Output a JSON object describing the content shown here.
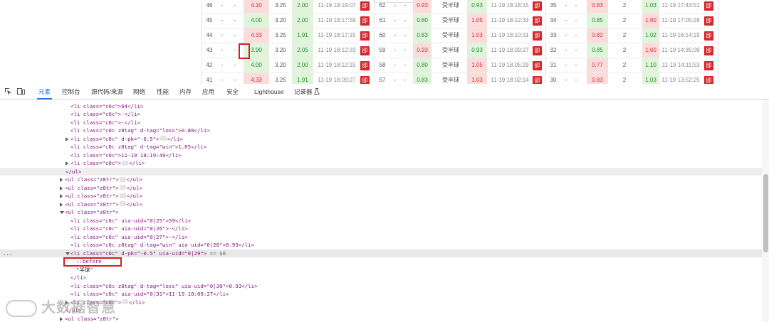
{
  "odds_table": {
    "rows": [
      {
        "a": {
          "id": "46",
          "d1": "-",
          "d2": "-",
          "v1": "4.10",
          "v2": "3.25",
          "v3": "2.00",
          "time": "11-19 18:19:07",
          "btn": "即"
        },
        "b": {
          "id": "62",
          "d1": "-",
          "d2": "-",
          "v1": "0.93",
          "pk": "受半球",
          "v2": "0.93",
          "time": "11-19 18:18:15",
          "btn": "即"
        },
        "c": {
          "id": "35",
          "d1": "-",
          "d2": "-",
          "v1": "0.83",
          "v2": "2",
          "v3": "1.03",
          "time": "11-19 17:43:51",
          "btn": "即"
        }
      },
      {
        "a": {
          "id": "45",
          "d1": "-",
          "d2": "-",
          "v1": "4.00",
          "v2": "3.20",
          "v3": "2.00",
          "time": "11-19 18:17:59",
          "btn": "即"
        },
        "b": {
          "id": "61",
          "d1": "-",
          "d2": "-",
          "v1": "0.80",
          "pk": "受半球",
          "v2": "1.05",
          "time": "11-19 18:12:33",
          "btn": "即"
        },
        "c": {
          "id": "34",
          "d1": "-",
          "d2": "-",
          "v1": "0.85",
          "v2": "2",
          "v3": "1.00",
          "time": "11-19 17:05:18",
          "btn": "即"
        }
      },
      {
        "a": {
          "id": "44",
          "d1": "-",
          "d2": "-",
          "v1": "4.33",
          "v2": "3.25",
          "v3": "1.91",
          "time": "11-19 18:17:15",
          "btn": "即"
        },
        "b": {
          "id": "60",
          "d1": "-",
          "d2": "-",
          "v1": "0.83",
          "pk": "受半球",
          "v2": "1.03",
          "time": "11-19 18:10:31",
          "btn": "即"
        },
        "c": {
          "id": "33",
          "d1": "-",
          "d2": "-",
          "v1": "0.82",
          "v2": "2",
          "v3": "1.02",
          "time": "11-19 16:14:19",
          "btn": "即"
        }
      },
      {
        "a": {
          "id": "43",
          "d1": "-",
          "d2": "-",
          "v1": "3.90",
          "v2": "3.20",
          "v3": "2.05",
          "time": "11-19 18:12:33",
          "btn": "即"
        },
        "b": {
          "id": "59",
          "d1": "-",
          "d2": "-",
          "v1": "0.93",
          "pk": "受半球",
          "v2": "0.93",
          "time": "11-19 18:09:27",
          "btn": "即"
        },
        "c": {
          "id": "32",
          "d1": "-",
          "d2": "-",
          "v1": "0.85",
          "v2": "2",
          "v3": "1.00",
          "time": "11-19 14:35:09",
          "btn": "即"
        }
      },
      {
        "a": {
          "id": "42",
          "d1": "-",
          "d2": "-",
          "v1": "4.00",
          "v2": "3.20",
          "v3": "2.00",
          "time": "11-19 18:12:15",
          "btn": "即"
        },
        "b": {
          "id": "58",
          "d1": "-",
          "d2": "-",
          "v1": "0.80",
          "pk": "受半球",
          "v2": "1.05",
          "time": "11-19 18:05:29",
          "btn": "即"
        },
        "c": {
          "id": "31",
          "d1": "-",
          "d2": "-",
          "v1": "0.77",
          "v2": "2",
          "v3": "1.10",
          "time": "11-19 14:11:53",
          "btn": "即"
        }
      },
      {
        "a": {
          "id": "41",
          "d1": "-",
          "d2": "-",
          "v1": "4.33",
          "v2": "3.25",
          "v3": "1.91",
          "time": "11-19 18:09:27",
          "btn": "即"
        },
        "b": {
          "id": "57",
          "d1": "-",
          "d2": "-",
          "v1": "0.83",
          "pk": "受半球",
          "v2": "1.03",
          "time": "11-19 18:02:14",
          "btn": "即"
        },
        "c": {
          "id": "30",
          "d1": "-",
          "d2": "-",
          "v1": "0.83",
          "v2": "2",
          "v3": "1.03",
          "time": "11-19 13:52:25",
          "btn": "即"
        }
      }
    ]
  },
  "devtools": {
    "tabs": [
      {
        "label": "元素",
        "active": true
      },
      {
        "label": "控制台"
      },
      {
        "label": "源代码/来源"
      },
      {
        "label": "网络"
      },
      {
        "label": "性能"
      },
      {
        "label": "内存"
      },
      {
        "label": "应用"
      },
      {
        "label": "安全"
      },
      {
        "label": "Lighthouse"
      },
      {
        "label": "记录器"
      }
    ],
    "dom_lines": {
      "l0": "<li class=\"c0c\">64</li>",
      "l1": "<li class=\"c0c\">-</li>",
      "l2": "<li class=\"c0c\">-</li>",
      "l3_pre": "<li class=\"c0c z8tag\" d-tag=\"loss\">0.80</li>",
      "l4_pre": "<li class=\"c0c\" d-pk=\"-0.5\">",
      "l4_post": "</li>",
      "l5": "<li class=\"c0c z8tag\" d-tag=\"win\">1.05</li>",
      "l6": "<li class=\"c0c\">11-19 18:19:49</li>",
      "l7_pre": "<li class=\"c0c\">",
      "l7_post": "</li>",
      "l8": "</ul>",
      "ul_pre": "<ul class=\"z8tr\">",
      "ul_post": "</ul>",
      "ul_open": "<ul class=\"z8tr\">",
      "m1": "<li class=\"c0c\" uia-uid=\"0|25\">59</li>",
      "m2": "<li class=\"c0c\" uia-uid=\"0|26\">-</li>",
      "m3": "<li class=\"c0c\" uia-uid=\"0|27\">-</li>",
      "m4": "<li class=\"c0c z8tag\" d-tag=\"win\" uia-uid=\"0|28\">0.93</li>",
      "m5": "<li class=\"c0c\" d-pk=\"-0.5\" uia-uid=\"0|29\">",
      "m5_eq": " == $0",
      "before": "::before",
      "text_node": "\"半球\"",
      "close_li": "</li>",
      "m6": "<li class=\"c0c z8tag\" d-tag=\"loss\" uia-uid=\"0|30\">0.93</li>",
      "m7": "<li class=\"c0c\" uia-uid=\"0|31\">11-19 18:09:27</li>",
      "m8_pre": "<li class=\"c0c\">",
      "m8_post": "</li>",
      "close_ul": "</ul>",
      "last_pre": "<ul class=\"z8tr\">"
    },
    "ellipsis": "..."
  },
  "watermark": "大数据智慧"
}
